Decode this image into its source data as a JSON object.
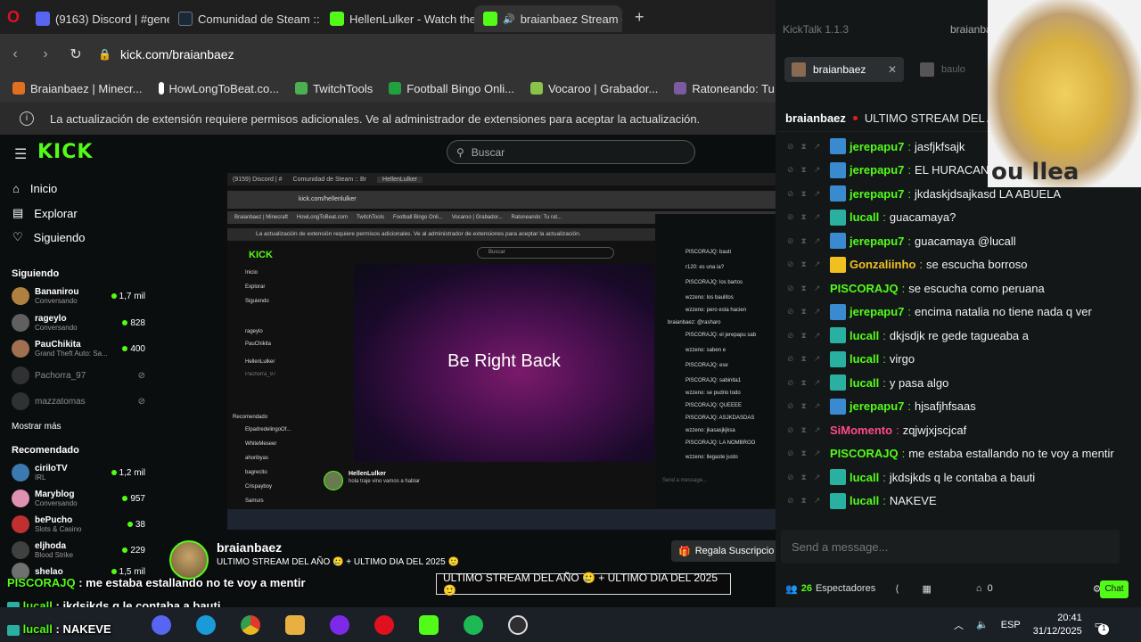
{
  "browser": {
    "tabs": [
      {
        "label": "(9163) Discord | #general",
        "color": "#5865f2"
      },
      {
        "label": "Comunidad de Steam :: Br",
        "color": "#1b2838"
      },
      {
        "label": "HellenLulker - Watch the",
        "color": "#53fc18"
      },
      {
        "label": "braianbaez Stream - V",
        "color": "#53fc18"
      }
    ],
    "new_tab_glyph": "+",
    "url": "kick.com/braianbaez",
    "bookmarks": [
      {
        "label": "Braianbaez | Minecr...",
        "color": "#e07020"
      },
      {
        "label": "HowLongToBeat.co...",
        "color": "#ffffff"
      },
      {
        "label": "TwitchTools",
        "color": "#4caf50"
      },
      {
        "label": "Football Bingo Onli...",
        "color": "#22a040"
      },
      {
        "label": "Vocaroo | Grabador...",
        "color": "#8bc34a"
      },
      {
        "label": "Ratoneando: Tu rat...",
        "color": "#7a5aa0"
      }
    ],
    "infobar": "La actualización de extensión requiere permisos adicionales. Ve al administrador de extensiones para aceptar la actualización."
  },
  "kick": {
    "logo": "KICK",
    "search_placeholder": "Buscar",
    "nav": [
      "Inicio",
      "Explorar",
      "Siguiendo"
    ],
    "following_header": "Siguiendo",
    "following": [
      {
        "name": "Bananirou",
        "sub": "Conversando",
        "viewers": "1,7 mil",
        "color": "#b08040"
      },
      {
        "name": "rageylo",
        "sub": "Conversando",
        "viewers": "828",
        "color": "#606060"
      },
      {
        "name": "PauChikita",
        "sub": "Grand Theft Auto: Sa...",
        "viewers": "400",
        "color": "#a07050"
      },
      {
        "name": "Pachorra_97",
        "sub": "",
        "viewers": "",
        "color": "#555555"
      },
      {
        "name": "mazzatomas",
        "sub": "",
        "viewers": "",
        "color": "#555555"
      }
    ],
    "show_more": "Mostrar más",
    "recommended_header": "Recomendado",
    "recommended": [
      {
        "name": "ciriloTV",
        "sub": "IRL",
        "viewers": "1,2 mil",
        "color": "#3a7ab0"
      },
      {
        "name": "Maryblog",
        "sub": "Conversando",
        "viewers": "957",
        "color": "#e090b0"
      },
      {
        "name": "bePucho",
        "sub": "Slots & Casino",
        "viewers": "38",
        "color": "#c03030"
      },
      {
        "name": "eljhoda",
        "sub": "Blood Strike",
        "viewers": "229",
        "color": "#404040"
      },
      {
        "name": "shelao",
        "sub": "",
        "viewers": "1,5 mil",
        "color": "#707070"
      }
    ],
    "streamer": {
      "name": "braianbaez",
      "title": "ULTIMO STREAM DEL AÑO 🥲 + ULTIMO DIA DEL 2025 🙂",
      "sub_button": "Regala Suscripcio"
    }
  },
  "embed": {
    "tabs": [
      "(9159) Discord | #",
      "Comunidad de Steam :: Br",
      "HellenLulker"
    ],
    "url": "kick.com/hellenlulker",
    "bookmarks": [
      "Braianbaez | Minecraft",
      "HowLongToBeat.com",
      "TwitchTools",
      "Football Bingo Onli...",
      "Vocaroo | Grabador...",
      "Ratoneando: Tu rat..."
    ],
    "infobar": "La actualización de extensión requiere permisos adicionales. Ve al administrador de extensiones para aceptar la actualización.",
    "video_text": "Be Right Back",
    "logo": "KICK",
    "search_placeholder": "Buscar",
    "nav": [
      "Inicio",
      "Explorar",
      "Siguiendo"
    ],
    "side": [
      "rageylo",
      "PauChikita",
      "HellenLulker",
      "Pachorra_97",
      "Recomendado",
      "ElpadredelingoOf...",
      "WhiteMeseer",
      "ahoribyas",
      "bagrecito",
      "Crispayboy",
      "Samurs"
    ],
    "chat": [
      "PISCORAJQ: bauti",
      "r120: es una ia?",
      "PISCORAJQ: los bartos",
      "wzzeno: los baulitos",
      "wzzeno: pero esta hacien",
      "braianbaez: @rasharo",
      "PISCORAJQ: el jerepapu sab",
      "wzzeno: saben e",
      "PISCORAJQ: ese",
      "PISCORAJQ: sabinita1",
      "wzzeno: se pudrio todo",
      "PISCORAJQ: QUEEEE",
      "PISCORAJQ: ASJKDASDAS",
      "wzzeno: jkasasjkjksa",
      "PISCORAJQ: LA NOMBROO",
      "wzzeno: llegaste justo"
    ],
    "streamer": "HellenLulker",
    "streamer_title": "hola traje vino vamos a hablar",
    "send_placeholder": "Send a message..."
  },
  "overlay": {
    "lines": [
      {
        "user": "PISCORAJQ",
        "text": "me estaba estallando no te voy a mentir",
        "color": "#53fc18"
      },
      {
        "user": "lucall",
        "text": "jkdsjkds q le contaba a bauti",
        "color": "#53fc18"
      },
      {
        "user": "lucall",
        "text": "NAKEVE",
        "color": "#53fc18"
      }
    ],
    "title_box": "ULTIMO STREAM DEL AÑO 🥲 + ULTIMO DIA DEL 2025 🙂"
  },
  "kicktalk": {
    "app_title": "KickTalk 1.1.3",
    "tab_active": "braianbaez",
    "tab_second": "braianba",
    "tab_third": "baulo",
    "channel": "braianbaez",
    "stream_title": "ULTIMO STREAM DEL A",
    "messages": [
      {
        "user": "jerepapu7",
        "text": "jasfjkfsajk",
        "color": "#53fc18",
        "badge": "#3a8ad0"
      },
      {
        "user": "jerepapu7",
        "text": "EL HURACAN",
        "color": "#53fc18",
        "badge": "#3a8ad0"
      },
      {
        "user": "jerepapu7",
        "text": "jkdaskjdsajkasd LA ABUELA",
        "color": "#53fc18",
        "badge": "#3a8ad0"
      },
      {
        "user": "lucall",
        "text": "guacamaya?",
        "color": "#53fc18",
        "badge": "#2ab0a0"
      },
      {
        "user": "jerepapu7",
        "text": "guacamaya @lucall",
        "color": "#53fc18",
        "badge": "#3a8ad0"
      },
      {
        "user": "Gonzaliinho",
        "text": "se escucha borroso",
        "color": "#f0c020",
        "badge": "#f0c020"
      },
      {
        "user": "PISCORAJQ",
        "text": "se escucha como peruana",
        "color": "#53fc18",
        "badge": ""
      },
      {
        "user": "jerepapu7",
        "text": "encima natalia no tiene nada q ver",
        "color": "#53fc18",
        "badge": "#3a8ad0"
      },
      {
        "user": "lucall",
        "text": "dkjsdjk re gede tagueaba a",
        "color": "#53fc18",
        "badge": "#2ab0a0"
      },
      {
        "user": "lucall",
        "text": "virgo",
        "color": "#53fc18",
        "badge": "#2ab0a0"
      },
      {
        "user": "lucall",
        "text": "y pasa algo",
        "color": "#53fc18",
        "badge": "#2ab0a0"
      },
      {
        "user": "jerepapu7",
        "text": "hjsafjhfsaas",
        "color": "#53fc18",
        "badge": "#3a8ad0"
      },
      {
        "user": "SiMomento",
        "text": "zqjwjxjscjcaf",
        "color": "#ff4a8a",
        "badge": ""
      },
      {
        "user": "PISCORAJQ",
        "text": "me estaba estallando no te voy a mentir",
        "color": "#53fc18",
        "badge": ""
      },
      {
        "user": "lucall",
        "text": "jkdsjkds q le contaba a bauti",
        "color": "#53fc18",
        "badge": "#2ab0a0"
      },
      {
        "user": "lucall",
        "text": "NAKEVE",
        "color": "#53fc18",
        "badge": "#2ab0a0"
      }
    ],
    "send_placeholder": "Send a message...",
    "viewers": "26",
    "viewers_label": "Espectadores",
    "count": "0",
    "chat_button": "Chat"
  },
  "cam_text": "ou llea",
  "taskbar": {
    "apps": [
      {
        "name": "discord",
        "color": "#5865f2"
      },
      {
        "name": "edge",
        "color": "#1a9ad6"
      },
      {
        "name": "chrome",
        "color": "#e8b820"
      },
      {
        "name": "explorer",
        "color": "#e8b040"
      },
      {
        "name": "canva",
        "color": "#7d2ae8"
      },
      {
        "name": "opera",
        "color": "#e01020"
      },
      {
        "name": "kick",
        "color": "#53fc18"
      },
      {
        "name": "spotify",
        "color": "#1db954"
      },
      {
        "name": "obs",
        "color": "#302e31"
      }
    ],
    "lang": "ESP",
    "time": "20:41",
    "date": "31/12/2025",
    "notif": "1"
  }
}
